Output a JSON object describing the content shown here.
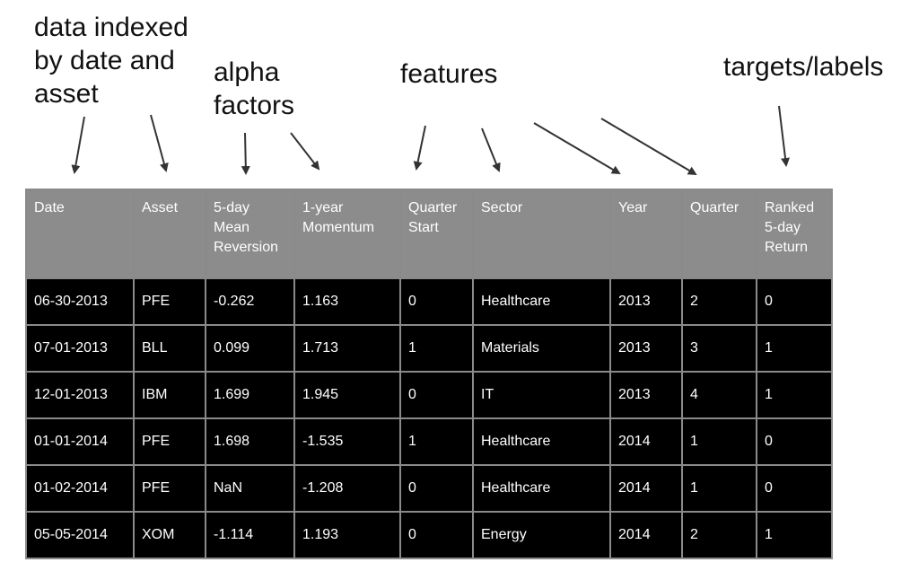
{
  "annotations": {
    "index": "data indexed\nby date and\nasset",
    "alpha": "alpha\nfactors",
    "features": "features",
    "targets": "targets/labels"
  },
  "table": {
    "headers": [
      "Date",
      "Asset",
      "5-day\nMean\nReversion",
      "1-year\nMomentum",
      "Quarter\nStart",
      "Sector",
      "Year",
      "Quarter",
      "Ranked\n5-day\nReturn"
    ],
    "rows": [
      [
        "06-30-2013",
        "PFE",
        "-0.262",
        "1.163",
        "0",
        "Healthcare",
        "2013",
        "2",
        "0"
      ],
      [
        "07-01-2013",
        "BLL",
        "0.099",
        "1.713",
        "1",
        "Materials",
        "2013",
        "3",
        "1"
      ],
      [
        "12-01-2013",
        "IBM",
        "1.699",
        "1.945",
        "0",
        "IT",
        "2013",
        "4",
        "1"
      ],
      [
        "01-01-2014",
        "PFE",
        "1.698",
        "-1.535",
        "1",
        "Healthcare",
        "2014",
        "1",
        "0"
      ],
      [
        "01-02-2014",
        "PFE",
        "NaN",
        "-1.208",
        "0",
        "Healthcare",
        "2014",
        "1",
        "0"
      ],
      [
        "05-05-2014",
        "XOM",
        "-1.114",
        "1.193",
        "0",
        "Energy",
        "2014",
        "2",
        "1"
      ]
    ]
  }
}
